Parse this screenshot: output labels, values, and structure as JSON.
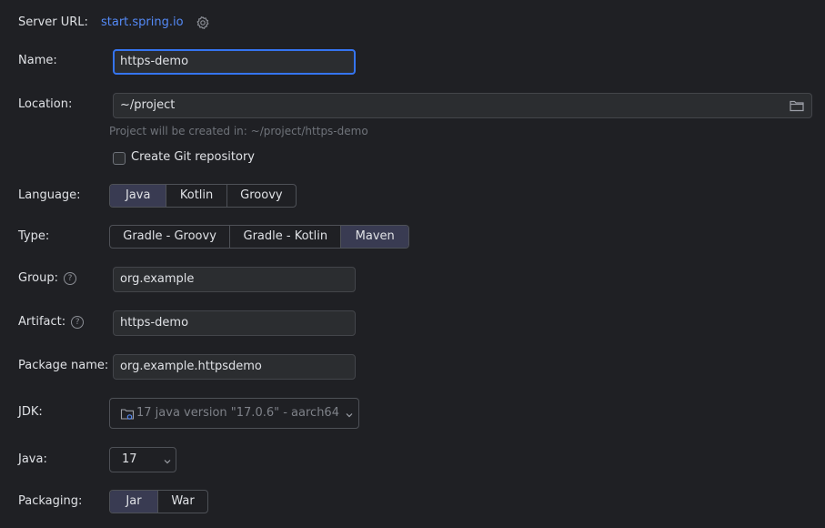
{
  "server": {
    "label": "Server URL:",
    "url": "start.spring.io",
    "settings_icon": "gear-icon"
  },
  "name": {
    "label": "Name:",
    "value": "https-demo"
  },
  "location": {
    "label": "Location:",
    "value": "~/project",
    "hint": "Project will be created in: ~/project/https-demo",
    "browse_icon": "folder-icon"
  },
  "git": {
    "label": "Create Git repository",
    "checked": false
  },
  "language": {
    "label": "Language:",
    "options": [
      "Java",
      "Kotlin",
      "Groovy"
    ],
    "selected": "Java"
  },
  "type": {
    "label": "Type:",
    "options": [
      "Gradle - Groovy",
      "Gradle - Kotlin",
      "Maven"
    ],
    "selected": "Maven"
  },
  "group": {
    "label": "Group:",
    "value": "org.example",
    "help_icon": "question-icon"
  },
  "artifact": {
    "label": "Artifact:",
    "value": "https-demo",
    "help_icon": "question-icon"
  },
  "package": {
    "label": "Package name:",
    "value": "org.example.httpsdemo"
  },
  "jdk": {
    "label": "JDK:",
    "value": "17 java version \"17.0.6\" - aarch64",
    "icon": "jdk-folder-icon"
  },
  "java": {
    "label": "Java:",
    "value": "17"
  },
  "packaging": {
    "label": "Packaging:",
    "options": [
      "Jar",
      "War"
    ],
    "selected": "Jar"
  },
  "colors": {
    "background": "#1f2024",
    "accent": "#3574f0",
    "link": "#548af7",
    "selected_segment": "#393b52"
  }
}
